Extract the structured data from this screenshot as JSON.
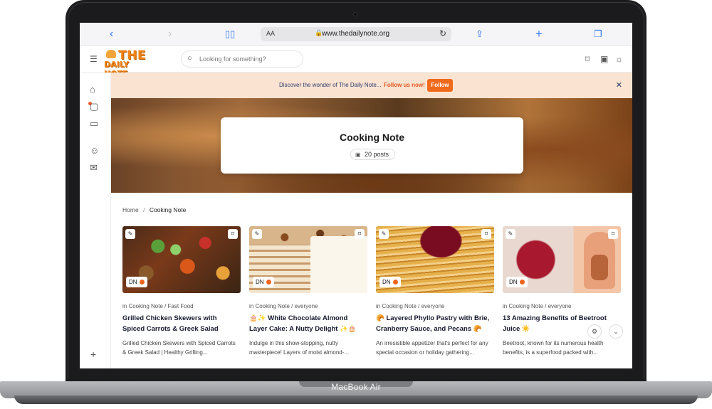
{
  "device": {
    "model_label": "MacBook Air"
  },
  "browser": {
    "text_size_label": "AA",
    "url": "www.thedailynote.org",
    "icons": [
      "chevron-left-icon",
      "chevron-right-icon",
      "book-icon",
      "lock-icon",
      "reload-icon",
      "share-icon",
      "plus-icon",
      "tabs-icon"
    ]
  },
  "site": {
    "logo_top": "THE",
    "logo_bottom": "DAILY NOTE",
    "search_placeholder": "Looking for something?",
    "header_icons": [
      "bookmark-icon",
      "translate-icon",
      "sun-icon"
    ]
  },
  "rail": {
    "icons": [
      "home-icon",
      "note-icon",
      "folder-icon",
      "users-icon",
      "message-icon",
      "plus-icon"
    ]
  },
  "banner": {
    "text": "Discover the wonder of The Daily Note...",
    "link": "Follow us now!",
    "button": "Follow"
  },
  "hero": {
    "title": "Cooking Note",
    "post_count": "20 posts"
  },
  "breadcrumb": {
    "home": "Home",
    "separator": "/",
    "current": "Cooking Note"
  },
  "cards": [
    {
      "badge": "DN",
      "category": "in Cooking Note / Fast Food",
      "title": "Grilled Chicken Skewers with Spiced Carrots & Greek Salad",
      "description": "Grilled Chicken Skewers with Spiced Carrots & Greek Salad | Healthy Grilling..."
    },
    {
      "badge": "DN",
      "category": "in Cooking Note / everyone",
      "title": "🎂✨ White Chocolate Almond Layer Cake: A Nutty Delight ✨🎂",
      "description": "Indulge in this show-stopping, nutty masterpiece! Layers of moist almond-..."
    },
    {
      "badge": "DN",
      "category": "in Cooking Note / everyone",
      "title": "🥐 Layered Phyllo Pastry with Brie, Cranberry Sauce, and Pecans 🥐",
      "description": "An irresistible appetizer that's perfect for any special occasion or holiday gathering..."
    },
    {
      "badge": "DN",
      "category": "in Cooking Note / everyone",
      "title": "13 Amazing Benefits of Beetroot Juice ☀️",
      "description": "Beetroot, known for its numerous health benefits, is a superfood packed with..."
    }
  ],
  "colors": {
    "accent": "#f06a1c",
    "banner_bg": "#fbe3d2",
    "link_blue": "#3478f6"
  }
}
